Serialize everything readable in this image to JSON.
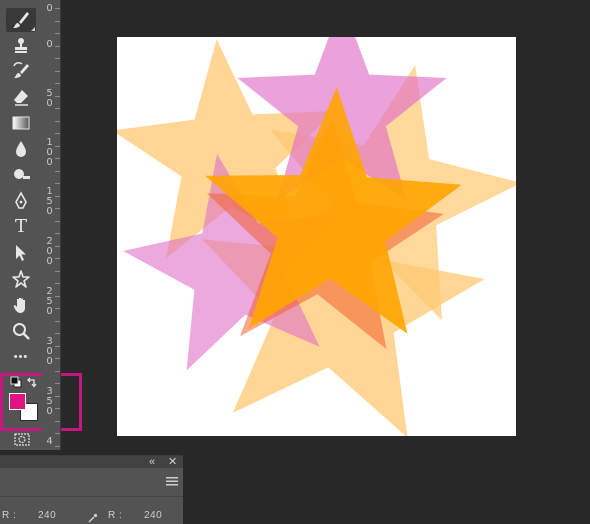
{
  "toolbar": {
    "tools": [
      {
        "name": "brush-tool",
        "icon": "brush-icon",
        "active": true
      },
      {
        "name": "clone-stamp-tool",
        "icon": "stamp-icon"
      },
      {
        "name": "history-brush-tool",
        "icon": "history-brush-icon"
      },
      {
        "name": "eraser-tool",
        "icon": "eraser-icon"
      },
      {
        "name": "gradient-tool",
        "icon": "gradient-icon"
      },
      {
        "name": "blur-tool",
        "icon": "drop-icon"
      },
      {
        "name": "dodge-tool",
        "icon": "dodge-icon"
      },
      {
        "name": "pen-tool",
        "icon": "pen-icon"
      },
      {
        "name": "type-tool",
        "icon": "type-icon",
        "label": "T"
      },
      {
        "name": "path-selection-tool",
        "icon": "arrow-icon"
      },
      {
        "name": "custom-shape-tool",
        "icon": "shape-icon"
      },
      {
        "name": "hand-tool",
        "icon": "hand-icon"
      },
      {
        "name": "zoom-tool",
        "icon": "zoom-icon"
      },
      {
        "name": "more-tools",
        "icon": "more-icon",
        "label": "•••"
      }
    ],
    "foreground_color": "#e0147f",
    "background_color": "#ffffff",
    "highlight_color": "#c8157f"
  },
  "ruler": {
    "labels": [
      "0",
      "0",
      "50",
      "100",
      "150",
      "200",
      "250",
      "300",
      "350",
      "4"
    ]
  },
  "canvas": {
    "background": "#ffffff",
    "star_colors": {
      "orange": "#ffa500",
      "light_orange": "#ffc872",
      "pink": "#e070c8",
      "red_orange": "#f06030"
    }
  },
  "info_panel": {
    "readouts": [
      {
        "label": "R :",
        "value": "240"
      },
      {
        "label": "R :",
        "value": "240"
      }
    ]
  }
}
